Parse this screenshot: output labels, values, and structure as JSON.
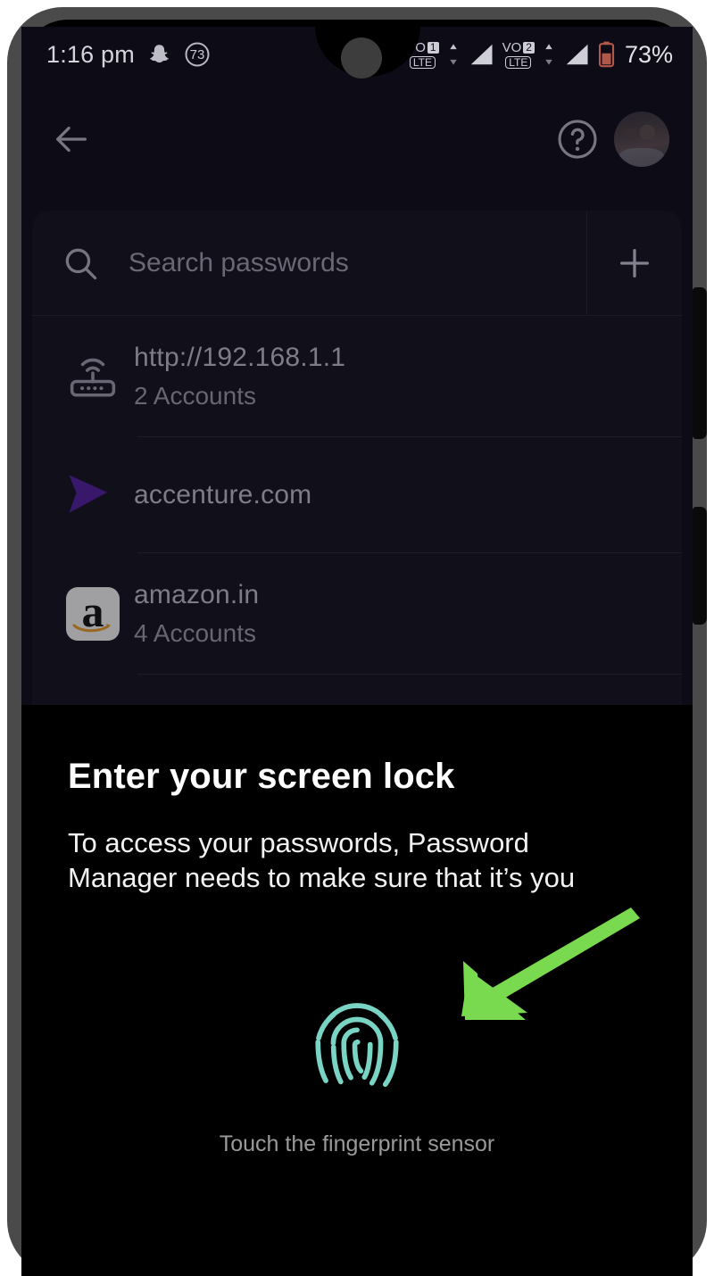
{
  "status_bar": {
    "time": "1:16 pm",
    "icons_left": [
      "snapchat-icon",
      "sleep-timer-73-icon"
    ],
    "timer_value": "73",
    "dot_icon": "notification-dot-icon",
    "sim1_label": "VO",
    "sim1_badge": "1",
    "sim1_network": "LTE",
    "sim2_label": "VO",
    "sim2_badge": "2",
    "sim2_network": "LTE",
    "battery_percent": "73%",
    "battery_color": "#b25a4a"
  },
  "app_header": {
    "back_icon": "back-arrow-icon",
    "help_icon": "help-circle-icon",
    "avatar_label": "account-avatar"
  },
  "search": {
    "placeholder": "Search passwords",
    "value": "",
    "search_icon": "search-icon",
    "add_icon": "plus-icon"
  },
  "password_list": [
    {
      "icon": "router-icon",
      "title": "http://192.168.1.1",
      "subtitle": "2 Accounts"
    },
    {
      "icon": "accenture-logo-icon",
      "title": "accenture.com",
      "subtitle": ""
    },
    {
      "icon": "amazon-logo-icon",
      "title": "amazon.in",
      "subtitle": "4 Accounts"
    }
  ],
  "biometric_prompt": {
    "title": "Enter your screen lock",
    "description": "To access your passwords, Password Manager needs to make sure that it’s you",
    "fingerprint_icon": "fingerprint-icon",
    "fingerprint_color": "#7ad4c4",
    "caption": "Touch the fingerprint sensor"
  },
  "annotation": {
    "arrow_icon": "green-pointer-arrow-icon",
    "color": "#79d94f"
  },
  "device": {
    "power_button": "power-button",
    "volume_button": "volume-button",
    "camera": "front-camera-lens"
  },
  "colors": {
    "accent_purple": "#4b1d8f",
    "sheet_background": "#000000",
    "app_background": "#0d0c16"
  }
}
